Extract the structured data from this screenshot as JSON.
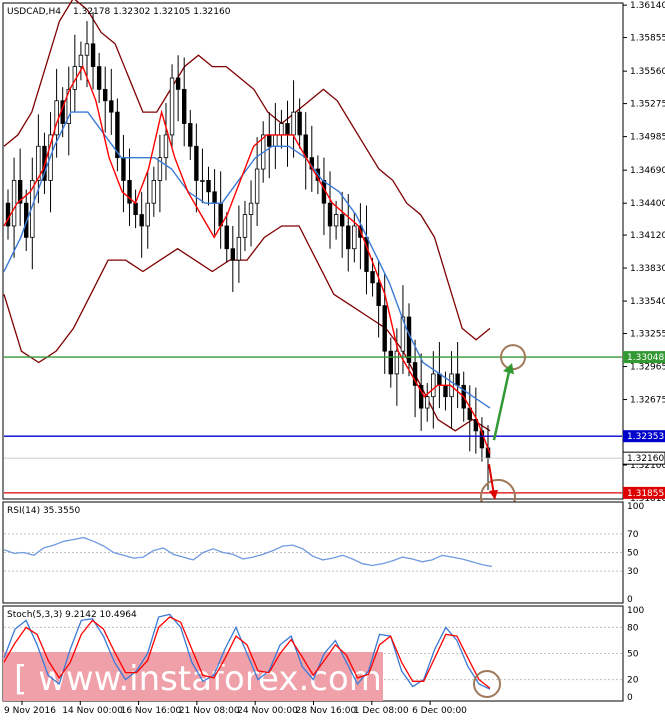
{
  "header": {
    "symbol": "USDCAD,H4",
    "ohlc": "1.32178 1.32302 1.32105 1.32160"
  },
  "rsi_label": "RSI(14) 35.3550",
  "stoch_label": "Stoch(5,3,3) 9.2142 10.4964",
  "watermark": "[  www.instaforex.com  ]",
  "colors": {
    "price": "#000000",
    "bands": "#800000",
    "fast_ma": "#ff0000",
    "slow_ma": "#3a7ad6",
    "resistance": "#339933",
    "support": "#0000cc",
    "target": "#dd0000",
    "circle": "#a0785a",
    "rsi": "#6f9be0",
    "stoch_main": "#3a7ad6",
    "stoch_signal": "#ff0000",
    "watermark_bg": "#f0a0a8"
  },
  "chart_data": [
    {
      "type": "candlestick",
      "title": "USDCAD,H4",
      "ylim": [
        1.3181,
        1.3615
      ],
      "y_ticks": [
        "1.36140",
        "1.35855",
        "1.35560",
        "1.35275",
        "1.34985",
        "1.34690",
        "1.34400",
        "1.34120",
        "1.33830",
        "1.33540",
        "1.33255",
        "1.32965",
        "1.32675",
        "1.32100",
        "1.31810"
      ],
      "x_ticks": [
        "9 Nov 2016",
        "14 Nov 00:00",
        "16 Nov 16:00",
        "21 Nov 08:00",
        "24 Nov 00:00",
        "28 Nov 16:00",
        "1 Dec 08:00",
        "6 Dec 00:00"
      ],
      "levels": [
        {
          "name": "resistance",
          "value": 1.33048,
          "label": "1.33048"
        },
        {
          "name": "support",
          "value": 1.32353,
          "label": "1.32353"
        },
        {
          "name": "target",
          "value": 1.31855,
          "label": "1.31855"
        }
      ],
      "last_price": {
        "value": 1.3216,
        "label": "1.32160"
      },
      "closes": [
        1.342,
        1.346,
        1.344,
        1.341,
        1.346,
        1.349,
        1.346,
        1.35,
        1.353,
        1.351,
        1.354,
        1.356,
        1.357,
        1.358,
        1.356,
        1.354,
        1.353,
        1.352,
        1.348,
        1.346,
        1.344,
        1.343,
        1.342,
        1.344,
        1.346,
        1.348,
        1.35,
        1.355,
        1.354,
        1.351,
        1.349,
        1.346,
        1.346,
        1.345,
        1.344,
        1.342,
        1.34,
        1.339,
        1.341,
        1.343,
        1.344,
        1.347,
        1.35,
        1.349,
        1.35,
        1.351,
        1.35,
        1.352,
        1.35,
        1.348,
        1.347,
        1.346,
        1.344,
        1.342,
        1.343,
        1.342,
        1.34,
        1.342,
        1.341,
        1.338,
        1.337,
        1.335,
        1.331,
        1.329,
        1.331,
        1.334,
        1.33,
        1.328,
        1.326,
        1.327,
        1.329,
        1.328,
        1.327,
        1.329,
        1.328,
        1.326,
        1.325,
        1.324,
        1.3225,
        1.3216
      ],
      "upper_band": [
        1.349,
        1.35,
        1.352,
        1.356,
        1.36,
        1.362,
        1.361,
        1.359,
        1.358,
        1.355,
        1.352,
        1.352,
        1.354,
        1.356,
        1.357,
        1.356,
        1.356,
        1.355,
        1.354,
        1.352,
        1.351,
        1.352,
        1.353,
        1.354,
        1.353,
        1.351,
        1.349,
        1.347,
        1.346,
        1.344,
        1.343,
        1.341,
        1.337,
        1.333,
        1.332,
        1.333
      ],
      "lower_band": [
        1.336,
        1.331,
        1.33,
        1.331,
        1.333,
        1.336,
        1.339,
        1.339,
        1.338,
        1.339,
        1.34,
        1.339,
        1.338,
        1.339,
        1.339,
        1.341,
        1.342,
        1.342,
        1.339,
        1.336,
        1.335,
        1.334,
        1.333,
        1.331,
        1.328,
        1.325,
        1.324,
        1.325,
        1.324
      ],
      "fast_ma": [
        1.342,
        1.344,
        1.345,
        1.347,
        1.351,
        1.354,
        1.356,
        1.353,
        1.348,
        1.345,
        1.344,
        1.347,
        1.352,
        1.348,
        1.345,
        1.343,
        1.341,
        1.343,
        1.346,
        1.349,
        1.35,
        1.35,
        1.35,
        1.348,
        1.346,
        1.344,
        1.343,
        1.342,
        1.339,
        1.336,
        1.331,
        1.329,
        1.327,
        1.328,
        1.328,
        1.327,
        1.325,
        1.322
      ],
      "slow_ma": [
        1.338,
        1.341,
        1.345,
        1.349,
        1.352,
        1.352,
        1.35,
        1.348,
        1.348,
        1.348,
        1.347,
        1.345,
        1.344,
        1.344,
        1.346,
        1.348,
        1.349,
        1.349,
        1.348,
        1.346,
        1.345,
        1.343,
        1.34,
        1.337,
        1.333,
        1.33,
        1.329,
        1.328,
        1.327,
        1.326
      ]
    },
    {
      "type": "line",
      "title": "RSI(14) 35.3550",
      "ylim": [
        0,
        100
      ],
      "y_ticks": [
        "100",
        "70",
        "50",
        "30",
        "0"
      ],
      "levels": [
        70,
        50,
        30
      ],
      "series": [
        {
          "name": "RSI(14)",
          "values": [
            53,
            49,
            50,
            47,
            55,
            58,
            62,
            64,
            66,
            62,
            57,
            50,
            47,
            44,
            45,
            52,
            55,
            48,
            45,
            42,
            50,
            54,
            50,
            48,
            43,
            45,
            48,
            52,
            57,
            58,
            54,
            46,
            42,
            44,
            47,
            43,
            38,
            36,
            38,
            41,
            45,
            43,
            40,
            42,
            47,
            45,
            43,
            40,
            37,
            35
          ]
        }
      ]
    },
    {
      "type": "line",
      "title": "Stoch(5,3,3) 9.2142 10.4964",
      "ylim": [
        0,
        100
      ],
      "y_ticks": [
        "100",
        "80",
        "50",
        "20",
        "0"
      ],
      "levels": [
        80,
        50,
        20
      ],
      "series": [
        {
          "name": "main",
          "values": [
            45,
            78,
            88,
            60,
            25,
            15,
            55,
            88,
            90,
            70,
            40,
            20,
            30,
            50,
            92,
            95,
            80,
            40,
            18,
            25,
            55,
            80,
            50,
            20,
            30,
            60,
            70,
            35,
            20,
            50,
            65,
            40,
            15,
            30,
            72,
            70,
            30,
            12,
            20,
            55,
            80,
            65,
            35,
            15,
            9
          ]
        },
        {
          "name": "signal",
          "values": [
            40,
            62,
            80,
            72,
            42,
            22,
            40,
            72,
            88,
            78,
            52,
            28,
            28,
            42,
            80,
            92,
            86,
            55,
            25,
            22,
            44,
            70,
            60,
            30,
            28,
            50,
            66,
            46,
            25,
            42,
            60,
            48,
            22,
            26,
            60,
            70,
            40,
            18,
            18,
            45,
            72,
            70,
            45,
            20,
            10
          ]
        }
      ]
    }
  ]
}
